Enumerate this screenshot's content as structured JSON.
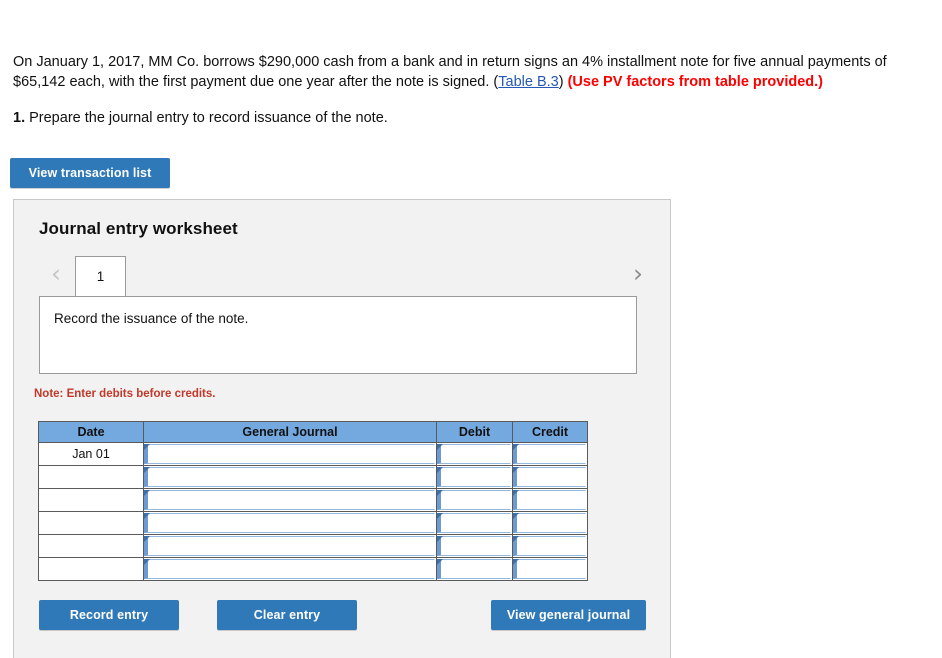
{
  "problem": {
    "text_part1": "On January 1, 2017, MM Co. borrows $290,000 cash from a bank and in return signs an 4% installment note for five annual payments of $65,142 each, with the first payment due one year after the note is signed. (",
    "link_label": "Table B.3",
    "text_part2": ") ",
    "emphasis": "(Use PV factors from table provided.)"
  },
  "requirement": {
    "number": "1.",
    "text": " Prepare the journal entry to record issuance of the note."
  },
  "toolbar": {
    "view_transaction_list_label": "View transaction list"
  },
  "worksheet": {
    "title": "Journal entry worksheet",
    "prev_icon": "‹",
    "next_icon": "›",
    "tabs": [
      {
        "label": "1",
        "active": true
      }
    ],
    "description": "Record the issuance of the note.",
    "note": "Note: Enter debits before credits."
  },
  "journal": {
    "columns": [
      "Date",
      "General Journal",
      "Debit",
      "Credit"
    ],
    "rows": [
      {
        "date": "Jan 01",
        "general_journal": "",
        "debit": "",
        "credit": ""
      },
      {
        "date": "",
        "general_journal": "",
        "debit": "",
        "credit": ""
      },
      {
        "date": "",
        "general_journal": "",
        "debit": "",
        "credit": ""
      },
      {
        "date": "",
        "general_journal": "",
        "debit": "",
        "credit": ""
      },
      {
        "date": "",
        "general_journal": "",
        "debit": "",
        "credit": ""
      },
      {
        "date": "",
        "general_journal": "",
        "debit": "",
        "credit": ""
      }
    ]
  },
  "actions": {
    "record_entry_label": "Record entry",
    "clear_entry_label": "Clear entry",
    "view_general_journal_label": "View general journal"
  },
  "colors": {
    "button_blue": "#3079b8",
    "table_header_blue": "#74a9e0",
    "panel_gray": "#f2f2f2",
    "note_red": "#c1392b",
    "emphasis_red": "#ff0000",
    "link_blue": "#2458b3",
    "input_accent_blue": "#6b9bd2"
  }
}
